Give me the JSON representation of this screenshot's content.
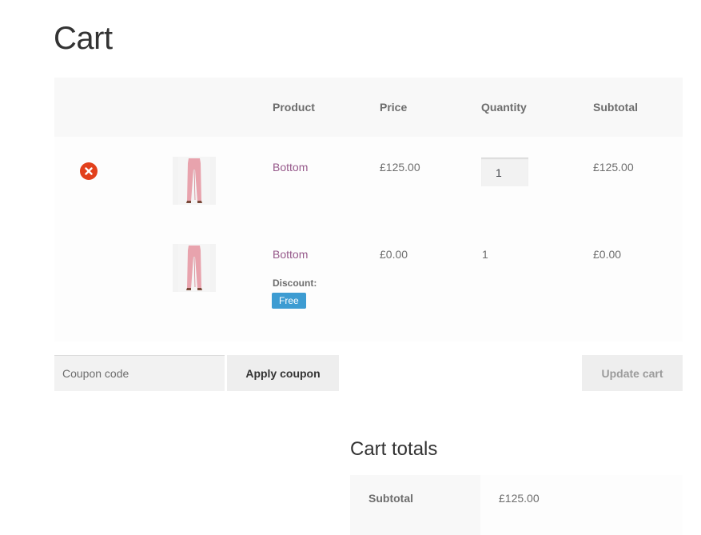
{
  "page": {
    "title": "Cart"
  },
  "cart_table": {
    "headers": {
      "product": "Product",
      "price": "Price",
      "quantity": "Quantity",
      "subtotal": "Subtotal"
    },
    "rows": [
      {
        "product": "Bottom",
        "price": "£125.00",
        "quantity": "1",
        "subtotal": "£125.00",
        "removable": true,
        "quantity_editable": true
      },
      {
        "product": "Bottom",
        "price": "£0.00",
        "quantity": "1",
        "subtotal": "£0.00",
        "removable": false,
        "quantity_editable": false,
        "discount_label": "Discount:",
        "discount_badge": "Free"
      }
    ]
  },
  "actions": {
    "coupon_placeholder": "Coupon code",
    "apply_coupon_label": "Apply coupon",
    "update_cart_label": "Update cart"
  },
  "totals": {
    "title": "Cart totals",
    "subtotal_label": "Subtotal",
    "subtotal_value": "£125.00"
  },
  "colors": {
    "link": "#96588a",
    "remove": "#e2401c",
    "badge": "#3d9cd2",
    "product_pink": "#e8a3ad"
  }
}
